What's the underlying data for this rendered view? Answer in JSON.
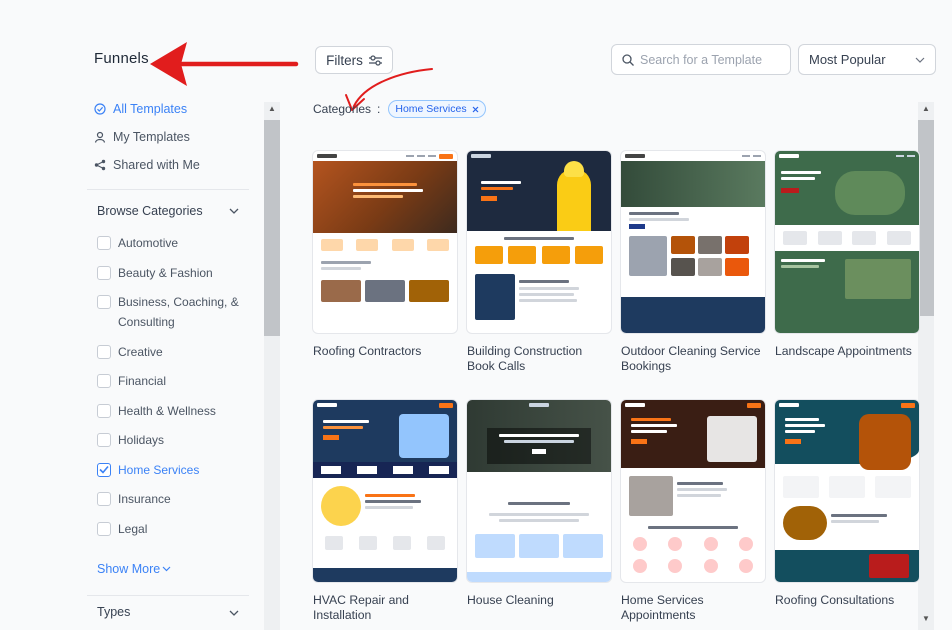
{
  "page": {
    "title": "Funnels",
    "filters_label": "Filters",
    "search_placeholder": "Search for a Template",
    "sort_value": "Most Popular",
    "categories_label": "Categories",
    "categories_separator": ":",
    "active_chip": "Home Services"
  },
  "sidebar": {
    "nav": [
      {
        "label": "All Templates",
        "icon": "check-circle-icon",
        "active": true
      },
      {
        "label": "My Templates",
        "icon": "user-icon",
        "active": false
      },
      {
        "label": "Shared with Me",
        "icon": "share-icon",
        "active": false
      }
    ],
    "browse_label": "Browse Categories",
    "categories": [
      {
        "label": "Automotive",
        "checked": false
      },
      {
        "label": "Beauty & Fashion",
        "checked": false
      },
      {
        "label": "Business, Coaching, & Consulting",
        "checked": false
      },
      {
        "label": "Creative",
        "checked": false
      },
      {
        "label": "Financial",
        "checked": false
      },
      {
        "label": "Health & Wellness",
        "checked": false
      },
      {
        "label": "Holidays",
        "checked": false
      },
      {
        "label": "Home Services",
        "checked": true
      },
      {
        "label": "Insurance",
        "checked": false
      },
      {
        "label": "Legal",
        "checked": false
      }
    ],
    "show_more": "Show More",
    "types_label": "Types"
  },
  "templates": [
    {
      "name": "Roofing Contractors"
    },
    {
      "name": "Building Construction Book Calls"
    },
    {
      "name": "Outdoor Cleaning Service Bookings"
    },
    {
      "name": "Landscape Appointments"
    },
    {
      "name": "HVAC Repair and Installation"
    },
    {
      "name": "House Cleaning"
    },
    {
      "name": "Home Services Appointments"
    },
    {
      "name": "Roofing Consultations"
    }
  ],
  "colors": {
    "accent": "#3b82f6",
    "annotation_red": "#e11d1d"
  }
}
